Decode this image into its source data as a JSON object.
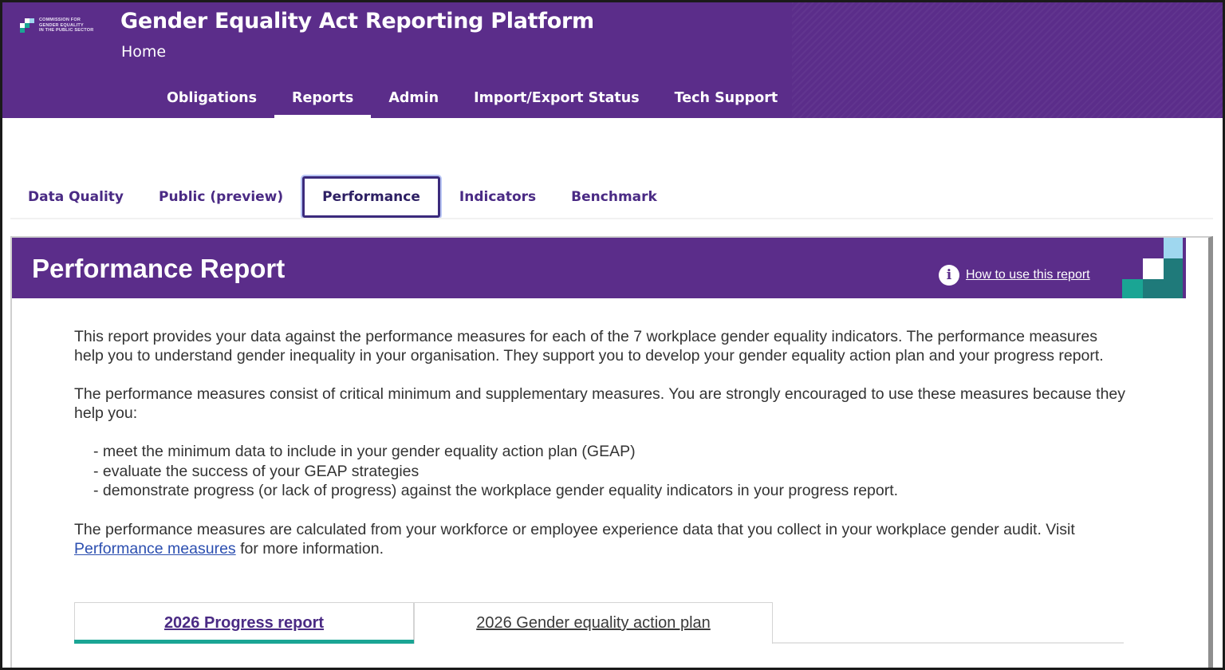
{
  "header": {
    "logo_lines": [
      "COMMISSION FOR",
      "GENDER EQUALITY",
      "IN THE PUBLIC SECTOR"
    ],
    "app_title": "Gender Equality Act Reporting Platform",
    "breadcrumb": "Home",
    "nav": [
      {
        "label": "Obligations"
      },
      {
        "label": "Reports",
        "active": true
      },
      {
        "label": "Admin"
      },
      {
        "label": "Import/Export Status"
      },
      {
        "label": "Tech Support"
      }
    ]
  },
  "subtabs": [
    {
      "label": "Data Quality"
    },
    {
      "label": "Public (preview)"
    },
    {
      "label": "Performance",
      "active": true
    },
    {
      "label": "Indicators"
    },
    {
      "label": "Benchmark"
    }
  ],
  "report": {
    "title": "Performance Report",
    "help_link": "How to use this report",
    "intro": "This report provides your data against the performance measures for each of the 7 workplace gender equality indicators. The performance measures help you to understand gender inequality in your organisation. They support you to develop your gender equality action plan and your progress report.",
    "measures_intro": "The performance measures consist of critical minimum and supplementary measures. You are strongly encouraged to use these measures because they help you:",
    "bullets": [
      "- meet the minimum data to include in your gender equality action plan (GEAP)",
      "- evaluate the success of your GEAP strategies",
      "- demonstrate progress (or lack of progress) against the workplace gender equality indicators in your progress report."
    ],
    "calc_text_before": "The performance measures are calculated from your workforce or employee experience data that you collect in your workplace gender audit. Visit ",
    "calc_link": "Performance measures",
    "calc_text_after": " for more information.",
    "report_tabs": [
      {
        "label": "2026 Progress report",
        "active": true
      },
      {
        "label": "2026 Gender equality action plan"
      }
    ]
  },
  "colors": {
    "brand_purple": "#5b2d8a",
    "teal_accent": "#1aa594",
    "link_blue": "#2c4fb0"
  }
}
